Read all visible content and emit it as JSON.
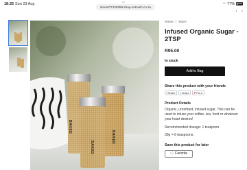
{
  "status": {
    "time": "18:25",
    "date": "Sun 23 Aug",
    "battery": "77%"
  },
  "browser": {
    "url": "store677128258.shop.netcash.co.za",
    "tab_dots": "•••"
  },
  "nav": {
    "back": "‹",
    "forward": "›"
  },
  "breadcrumb": {
    "home": "Home",
    "sep": "/",
    "store": "Store"
  },
  "product": {
    "title": "Infused Organic Sugar - 2TSP",
    "price": "R95.00",
    "stock": "In stock",
    "add_label": "Add to Bag",
    "jar_brand": "BAKED"
  },
  "share": {
    "heading": "Share this product with your friends",
    "buttons": [
      {
        "icon": "f",
        "label": "Share"
      },
      {
        "icon": "t",
        "label": "Share"
      },
      {
        "icon": "P",
        "label": "Pin it"
      }
    ]
  },
  "details": {
    "heading": "Product Details",
    "description": "Organic, unrefined, infused sugar. This can be used to infuse your coffee, tea, food or whatever your heart desires!",
    "dosage": "Recommended dosage: 1 teaspoon.",
    "qty": "30g = 6 teaspoons."
  },
  "save": {
    "heading": "Save this product for later",
    "favorite_label": "Favorite"
  },
  "colors": {
    "accent": "#111111",
    "thumb_active": "#3b7bd6",
    "sugar": "#c9a86a"
  }
}
